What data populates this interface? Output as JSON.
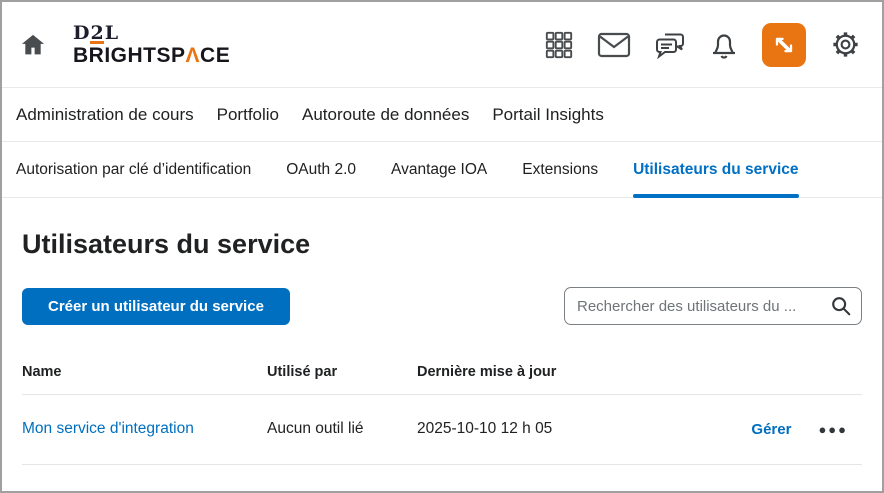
{
  "topbar": {
    "brand": {
      "d2l_d": "D",
      "d2l_2": "2",
      "d2l_l": "L",
      "name_pre": "BRIGHTSP",
      "name_a": "Λ",
      "name_post": "CE"
    },
    "icons": [
      "home",
      "apps-grid",
      "mail",
      "chat",
      "notifications-bell",
      "data-sync",
      "settings-gear"
    ]
  },
  "nav": {
    "items": [
      "Administration de cours",
      "Portfolio",
      "Autoroute de données",
      "Portail Insights"
    ]
  },
  "tabs": {
    "items": [
      "Autorisation par clé d’identification",
      "OAuth 2.0",
      "Avantage IOA",
      "Extensions",
      "Utilisateurs du service"
    ],
    "active": "Utilisateurs du service"
  },
  "page": {
    "title": "Utilisateurs du service"
  },
  "toolbar": {
    "create_button": "Créer un utilisateur du service",
    "search_placeholder": "Rechercher des utilisateurs du ..."
  },
  "table": {
    "headers": [
      "Name",
      "Utilisé par",
      "Dernière mise à jour"
    ],
    "rows": [
      {
        "name": "Mon service d'integration",
        "used_by": "Aucun outil lié",
        "updated": "2025-10-10 12 h 05",
        "manage": "Gérer",
        "more": "●●●"
      }
    ]
  },
  "colors": {
    "primary_blue": "#006fbf",
    "active_tab_blue": "#0070c4",
    "accent_orange": "#e87511",
    "text": "#202122",
    "divider": "#e8e8e8"
  }
}
